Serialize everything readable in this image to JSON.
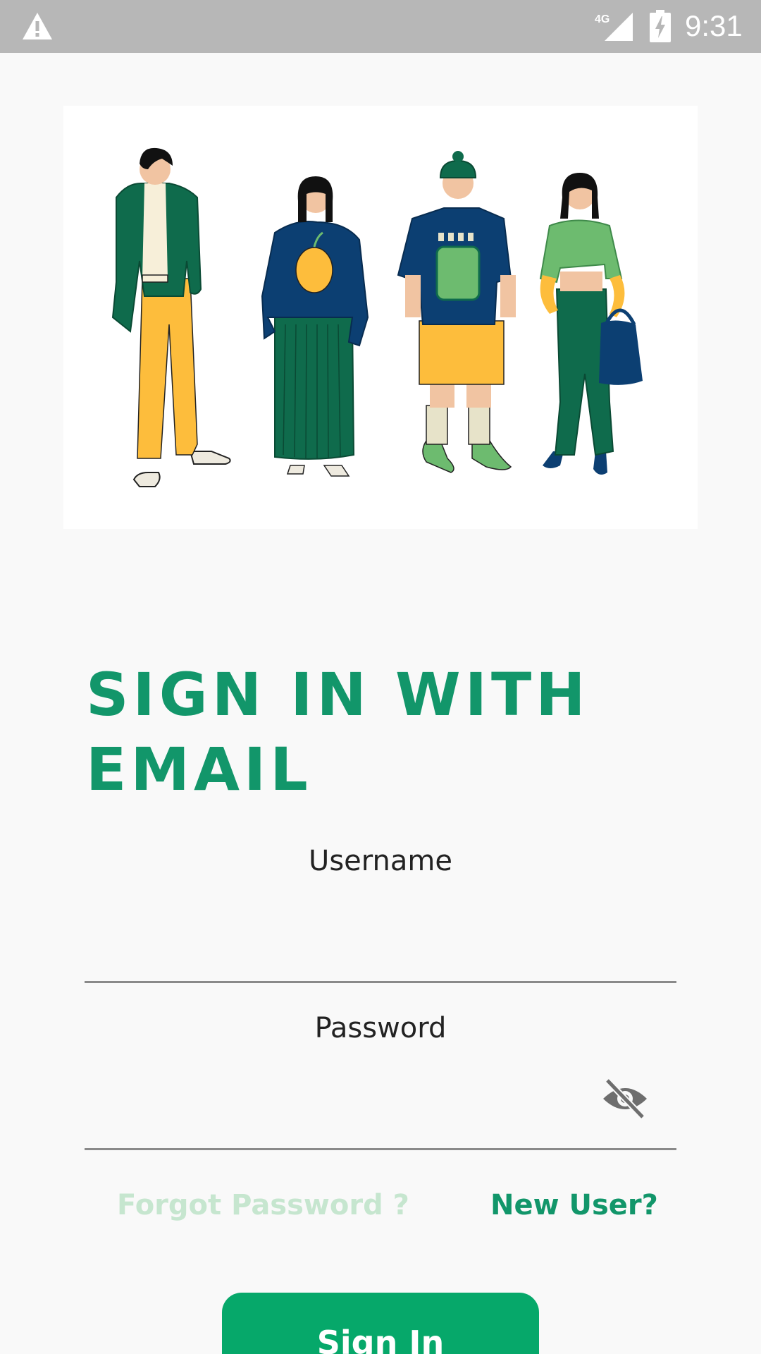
{
  "status_bar": {
    "network": "4G",
    "time": "9:31",
    "icons": [
      "warning-icon",
      "cellular-signal-icon",
      "battery-charging-icon"
    ]
  },
  "illustration": {
    "icon": "people-illustration",
    "colors": {
      "green": "#0f6b4c",
      "yellow": "#fdbd3c",
      "navy": "#0c3f72",
      "light_green": "#6dbb6f",
      "skin": "#f1c4a2"
    }
  },
  "form": {
    "title": "SIGN IN WITH EMAIL",
    "username_label": "Username",
    "username_value": "",
    "password_label": "Password",
    "password_value": "",
    "password_toggle_icon": "eye-off-icon",
    "forgot_password": "Forgot Password ?",
    "new_user": "New User?",
    "sign_in": "Sign In"
  },
  "colors": {
    "accent": "#12966a",
    "button": "#06a86a",
    "link_disabled": "#c6e6cf",
    "background": "#f9f9f9",
    "status_bar": "#b7b7b7"
  }
}
